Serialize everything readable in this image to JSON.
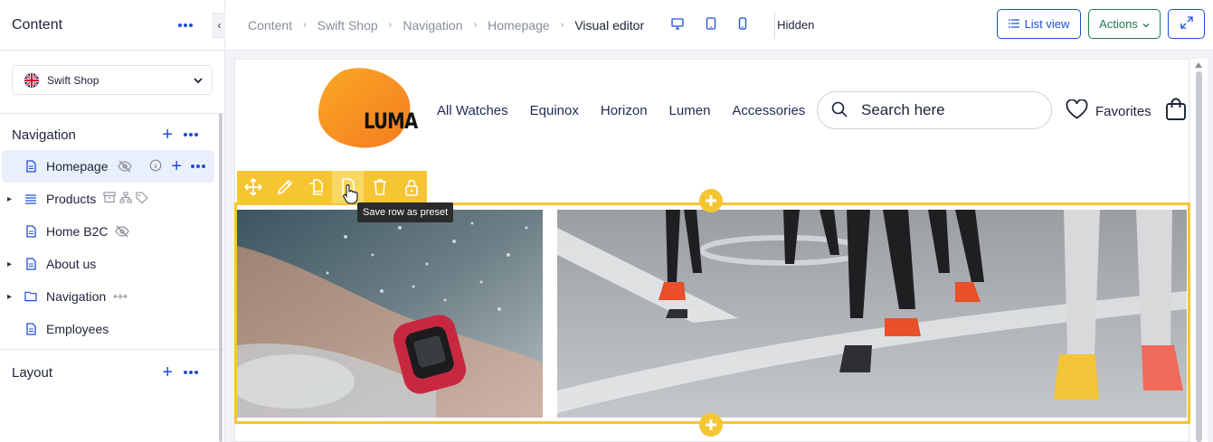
{
  "sidebar": {
    "title": "Content",
    "collapse_icon": "chevron-left-icon",
    "shop_selector": {
      "label": "Swift Shop",
      "flag_icon": "uk-flag-icon"
    },
    "navigation": {
      "label": "Navigation",
      "items": [
        {
          "label": "Homepage",
          "icon": "page-icon",
          "active": true,
          "badges": [
            "eye-off-icon"
          ]
        },
        {
          "label": "Products",
          "icon": "list-icon",
          "expandable": true,
          "badges": [
            "archive-icon",
            "sitemap-icon",
            "tag-icon"
          ]
        },
        {
          "label": "Home B2C",
          "icon": "page-icon",
          "badges": [
            "eye-off-icon"
          ]
        },
        {
          "label": "About us",
          "icon": "page-icon",
          "expandable": true
        },
        {
          "label": "Navigation",
          "icon": "folder-icon",
          "expandable": true,
          "badges": [
            "move-horizontal-icon"
          ]
        },
        {
          "label": "Employees",
          "icon": "page-icon"
        }
      ]
    },
    "layout": {
      "label": "Layout"
    }
  },
  "topbar": {
    "breadcrumbs": [
      "Content",
      "Swift Shop",
      "Navigation",
      "Homepage",
      "Visual editor"
    ],
    "devices": [
      "desktop-icon",
      "tablet-icon",
      "mobile-icon"
    ],
    "visibility_label": "Hidden",
    "list_view_label": "List view",
    "actions_label": "Actions"
  },
  "site": {
    "logo_text": "LUMA",
    "menu": [
      "All Watches",
      "Equinox",
      "Horizon",
      "Lumen",
      "Accessories"
    ],
    "search_placeholder": "Search here",
    "favorites_label": "Favorites"
  },
  "editor": {
    "toolbar_icons": [
      "move-icon",
      "edit-icon",
      "copy-icon",
      "save-preset-icon",
      "trash-icon",
      "lock-icon"
    ],
    "tooltip": "Save row as preset"
  },
  "colors": {
    "accent": "#1d4ed8",
    "actions_green": "#1e7a4c",
    "selection_yellow": "#f6c532",
    "logo_orange": "#f7941d"
  }
}
